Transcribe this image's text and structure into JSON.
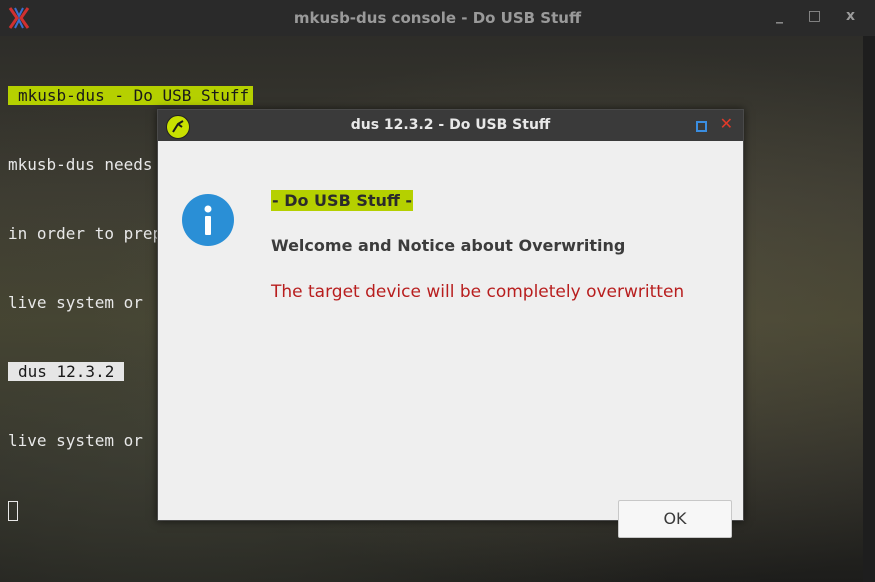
{
  "console": {
    "title": "mkusb-dus console - Do USB Stuff",
    "controls": "_ □ x",
    "lines": {
      "header": "mkusb-dus - Do USB Stuff",
      "l1": "mkusb-dus needs superuser permissions (sudo) for some tasks,",
      "l2": "in order to prepare and write to the target, a block device.",
      "l3": "live system or",
      "version": "dus 12.3.2",
      "l5": "live system or"
    }
  },
  "dialog": {
    "title": "dus 12.3.2 - Do USB Stuff",
    "close_glyph": "✕",
    "icon": "info-icon",
    "heading": "- Do USB Stuff -",
    "subheading": "Welcome and Notice about Overwriting",
    "warning": "The target device will be completely overwritten",
    "ok_label": "OK"
  },
  "colors": {
    "accent_green": "#b5d000",
    "warning_red": "#b81e1e",
    "info_blue": "#2a8fd6"
  }
}
